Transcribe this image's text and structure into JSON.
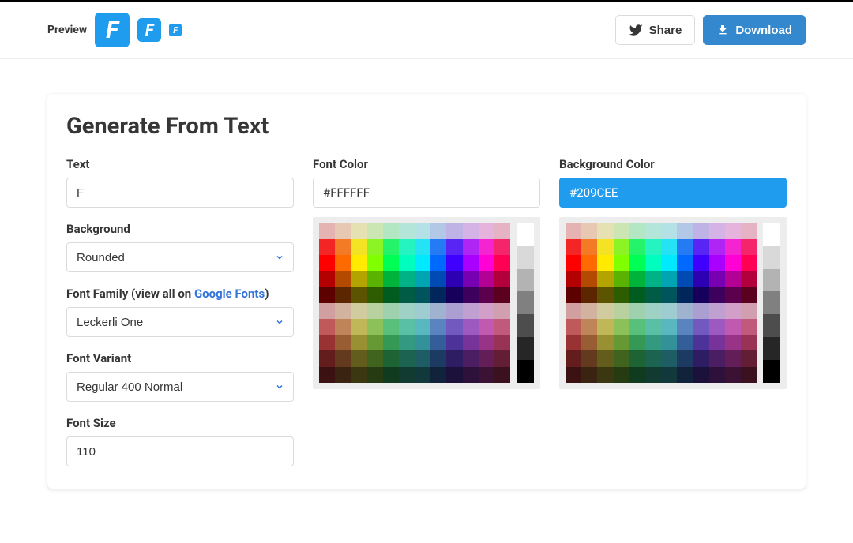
{
  "header": {
    "preview_label": "Preview",
    "preview_letter": "F",
    "share_label": "Share",
    "download_label": "Download"
  },
  "card": {
    "title": "Generate From Text",
    "text_label": "Text",
    "text_value": "F",
    "background_label": "Background",
    "background_value": "Rounded",
    "font_family_label_prefix": "Font Family (view all on ",
    "font_family_link": "Google Fonts",
    "font_family_label_suffix": ")",
    "font_family_value": "Leckerli One",
    "font_variant_label": "Font Variant",
    "font_variant_value": "Regular 400 Normal",
    "font_size_label": "Font Size",
    "font_size_value": "110",
    "font_color_label": "Font Color",
    "font_color_value": "#FFFFFF",
    "bg_color_label": "Background Color",
    "bg_color_value": "#209CEE"
  },
  "palette": {
    "hues": [
      "#804040",
      "#c06020",
      "#c0c020",
      "#80c020",
      "#20c020",
      "#20c080",
      "#20c0c0",
      "#2080c0",
      "#2020c0",
      "#6020c0",
      "#c020c0",
      "#c02080"
    ],
    "rows": [
      {
        "s": 0.5,
        "l": 0.8
      },
      {
        "s": 0.9,
        "l": 0.55
      },
      {
        "s": 1.0,
        "l": 0.5
      },
      {
        "s": 1.0,
        "l": 0.35
      },
      {
        "s": 1.0,
        "l": 0.18
      },
      {
        "s": 0.35,
        "l": 0.72
      },
      {
        "s": 0.45,
        "l": 0.55
      },
      {
        "s": 0.5,
        "l": 0.4
      },
      {
        "s": 0.55,
        "l": 0.25
      },
      {
        "s": 0.55,
        "l": 0.15
      }
    ],
    "grays": [
      "#ffffff",
      "#d9d9d9",
      "#b3b3b3",
      "#808080",
      "#4d4d4d",
      "#262626",
      "#000000"
    ],
    "baseHues": [
      0,
      25,
      55,
      90,
      140,
      165,
      185,
      215,
      255,
      280,
      310,
      340
    ]
  }
}
